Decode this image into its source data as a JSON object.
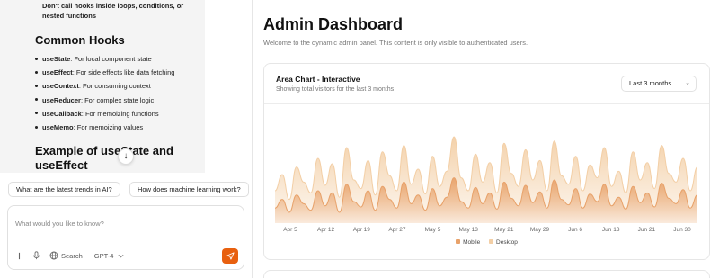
{
  "chat": {
    "tip_text": "Don't call hooks inside loops, conditions, or nested functions",
    "common_hooks_heading": "Common Hooks",
    "hooks": [
      {
        "name": "useState",
        "desc": ": For local component state"
      },
      {
        "name": "useEffect",
        "desc": ": For side effects like data fetching"
      },
      {
        "name": "useContext",
        "desc": ": For consuming context"
      },
      {
        "name": "useReducer",
        "desc": ": For complex state logic"
      },
      {
        "name": "useCallback",
        "desc": ": For memoizing functions"
      },
      {
        "name": "useMemo",
        "desc": ": For memoizing values"
      }
    ],
    "example_heading": "Example of useState and useEffect",
    "suggestions": [
      "What are the latest trends in AI?",
      "How does machine learning work?"
    ],
    "input_placeholder": "What would you like to know?",
    "search_label": "Search",
    "model_label": "GPT-4",
    "icons": [
      "plus-icon",
      "microphone-icon",
      "globe-icon",
      "chevron-down-icon",
      "send-icon",
      "arrow-down-icon"
    ]
  },
  "dashboard": {
    "title": "Admin Dashboard",
    "subtitle": "Welcome to the dynamic admin panel. This content is only visible to authenticated users.",
    "card_title": "Area Chart - Interactive",
    "card_desc": "Showing total visitors for the last 3 months",
    "range_value": "Last 3 months"
  },
  "colors": {
    "accent": "#e8600f",
    "mobile": "#e8a26a",
    "desktop": "#f3cfa6"
  },
  "chart_data": {
    "type": "area",
    "x_ticks": [
      "Apr 5",
      "Apr 12",
      "Apr 19",
      "Apr 27",
      "May 5",
      "May 13",
      "May 21",
      "May 29",
      "Jun 6",
      "Jun 13",
      "Jun 21",
      "Jun 30"
    ],
    "series": [
      {
        "name": "Desktop",
        "values": [
          30,
          45,
          22,
          52,
          38,
          28,
          60,
          35,
          55,
          24,
          70,
          40,
          32,
          58,
          26,
          66,
          44,
          30,
          72,
          36,
          50,
          27,
          62,
          34,
          48,
          80,
          42,
          30,
          64,
          38,
          56,
          28,
          74,
          46,
          34,
          68,
          40,
          58,
          30,
          76,
          44,
          36,
          62,
          30,
          54,
          42,
          70,
          34,
          48,
          28,
          66,
          40,
          56,
          32,
          72,
          46,
          38,
          60,
          30,
          52
        ]
      },
      {
        "name": "Mobile",
        "values": [
          14,
          22,
          10,
          26,
          18,
          12,
          30,
          16,
          28,
          10,
          36,
          20,
          15,
          30,
          12,
          34,
          22,
          14,
          38,
          18,
          26,
          12,
          32,
          16,
          24,
          42,
          20,
          14,
          33,
          18,
          28,
          13,
          38,
          23,
          16,
          35,
          19,
          29,
          14,
          40,
          22,
          17,
          32,
          14,
          27,
          20,
          36,
          16,
          24,
          13,
          34,
          19,
          28,
          15,
          37,
          23,
          18,
          31,
          14,
          26
        ]
      }
    ],
    "legend": [
      "Mobile",
      "Desktop"
    ],
    "legend_position": "bottom-center",
    "grid": false
  }
}
